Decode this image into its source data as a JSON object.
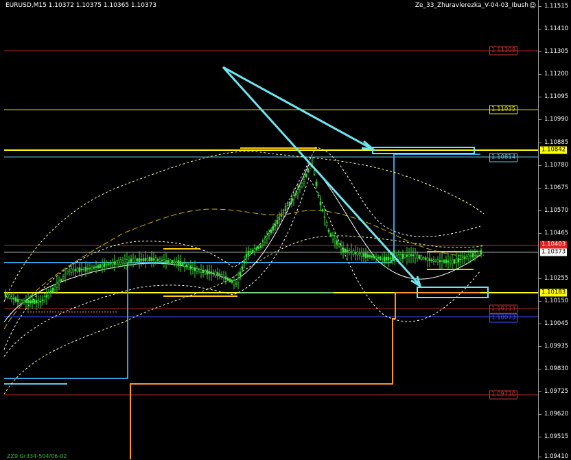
{
  "header": {
    "symbol_info": "EURUSD,M15  1.10372 1.10375 1.10365 1.10373",
    "indicator": "Ze_33_Zhuravlerezka_V-04-03_Ibush"
  },
  "footer": {
    "text": "ZZ9 Gr334-504/06-02"
  },
  "price_axis": {
    "ticks": [
      "1.11515",
      "1.11410",
      "1.11305",
      "1.11200",
      "1.11095",
      "1.10990",
      "1.10885",
      "1.10780",
      "1.10675",
      "1.10570",
      "1.10465",
      "1.10255",
      "1.10150",
      "1.10045",
      "1.09935",
      "1.09830",
      "1.09725",
      "1.09620",
      "1.09515",
      "1.09410"
    ],
    "tags": [
      {
        "label": "1.10842",
        "color": "#ffff00",
        "text_color": "#000"
      },
      {
        "label": "1.10403",
        "color": "#e02020",
        "text_color": "#fff"
      },
      {
        "label": "1.10373",
        "color": "#ffffff",
        "text_color": "#000"
      },
      {
        "label": "1.10183",
        "color": "#ffff00",
        "text_color": "#000"
      }
    ]
  },
  "levels": [
    {
      "label": "1.11308",
      "color": "#c83232"
    },
    {
      "label": "1.11035",
      "color": "#e6e600"
    },
    {
      "label": "1.10814",
      "color": "#5fc8e6"
    },
    {
      "label": "1.10113",
      "color": "#c83232"
    },
    {
      "label": "1.10073",
      "color": "#3c50ff"
    },
    {
      "label": "1.09710",
      "color": "#c83232"
    }
  ]
}
